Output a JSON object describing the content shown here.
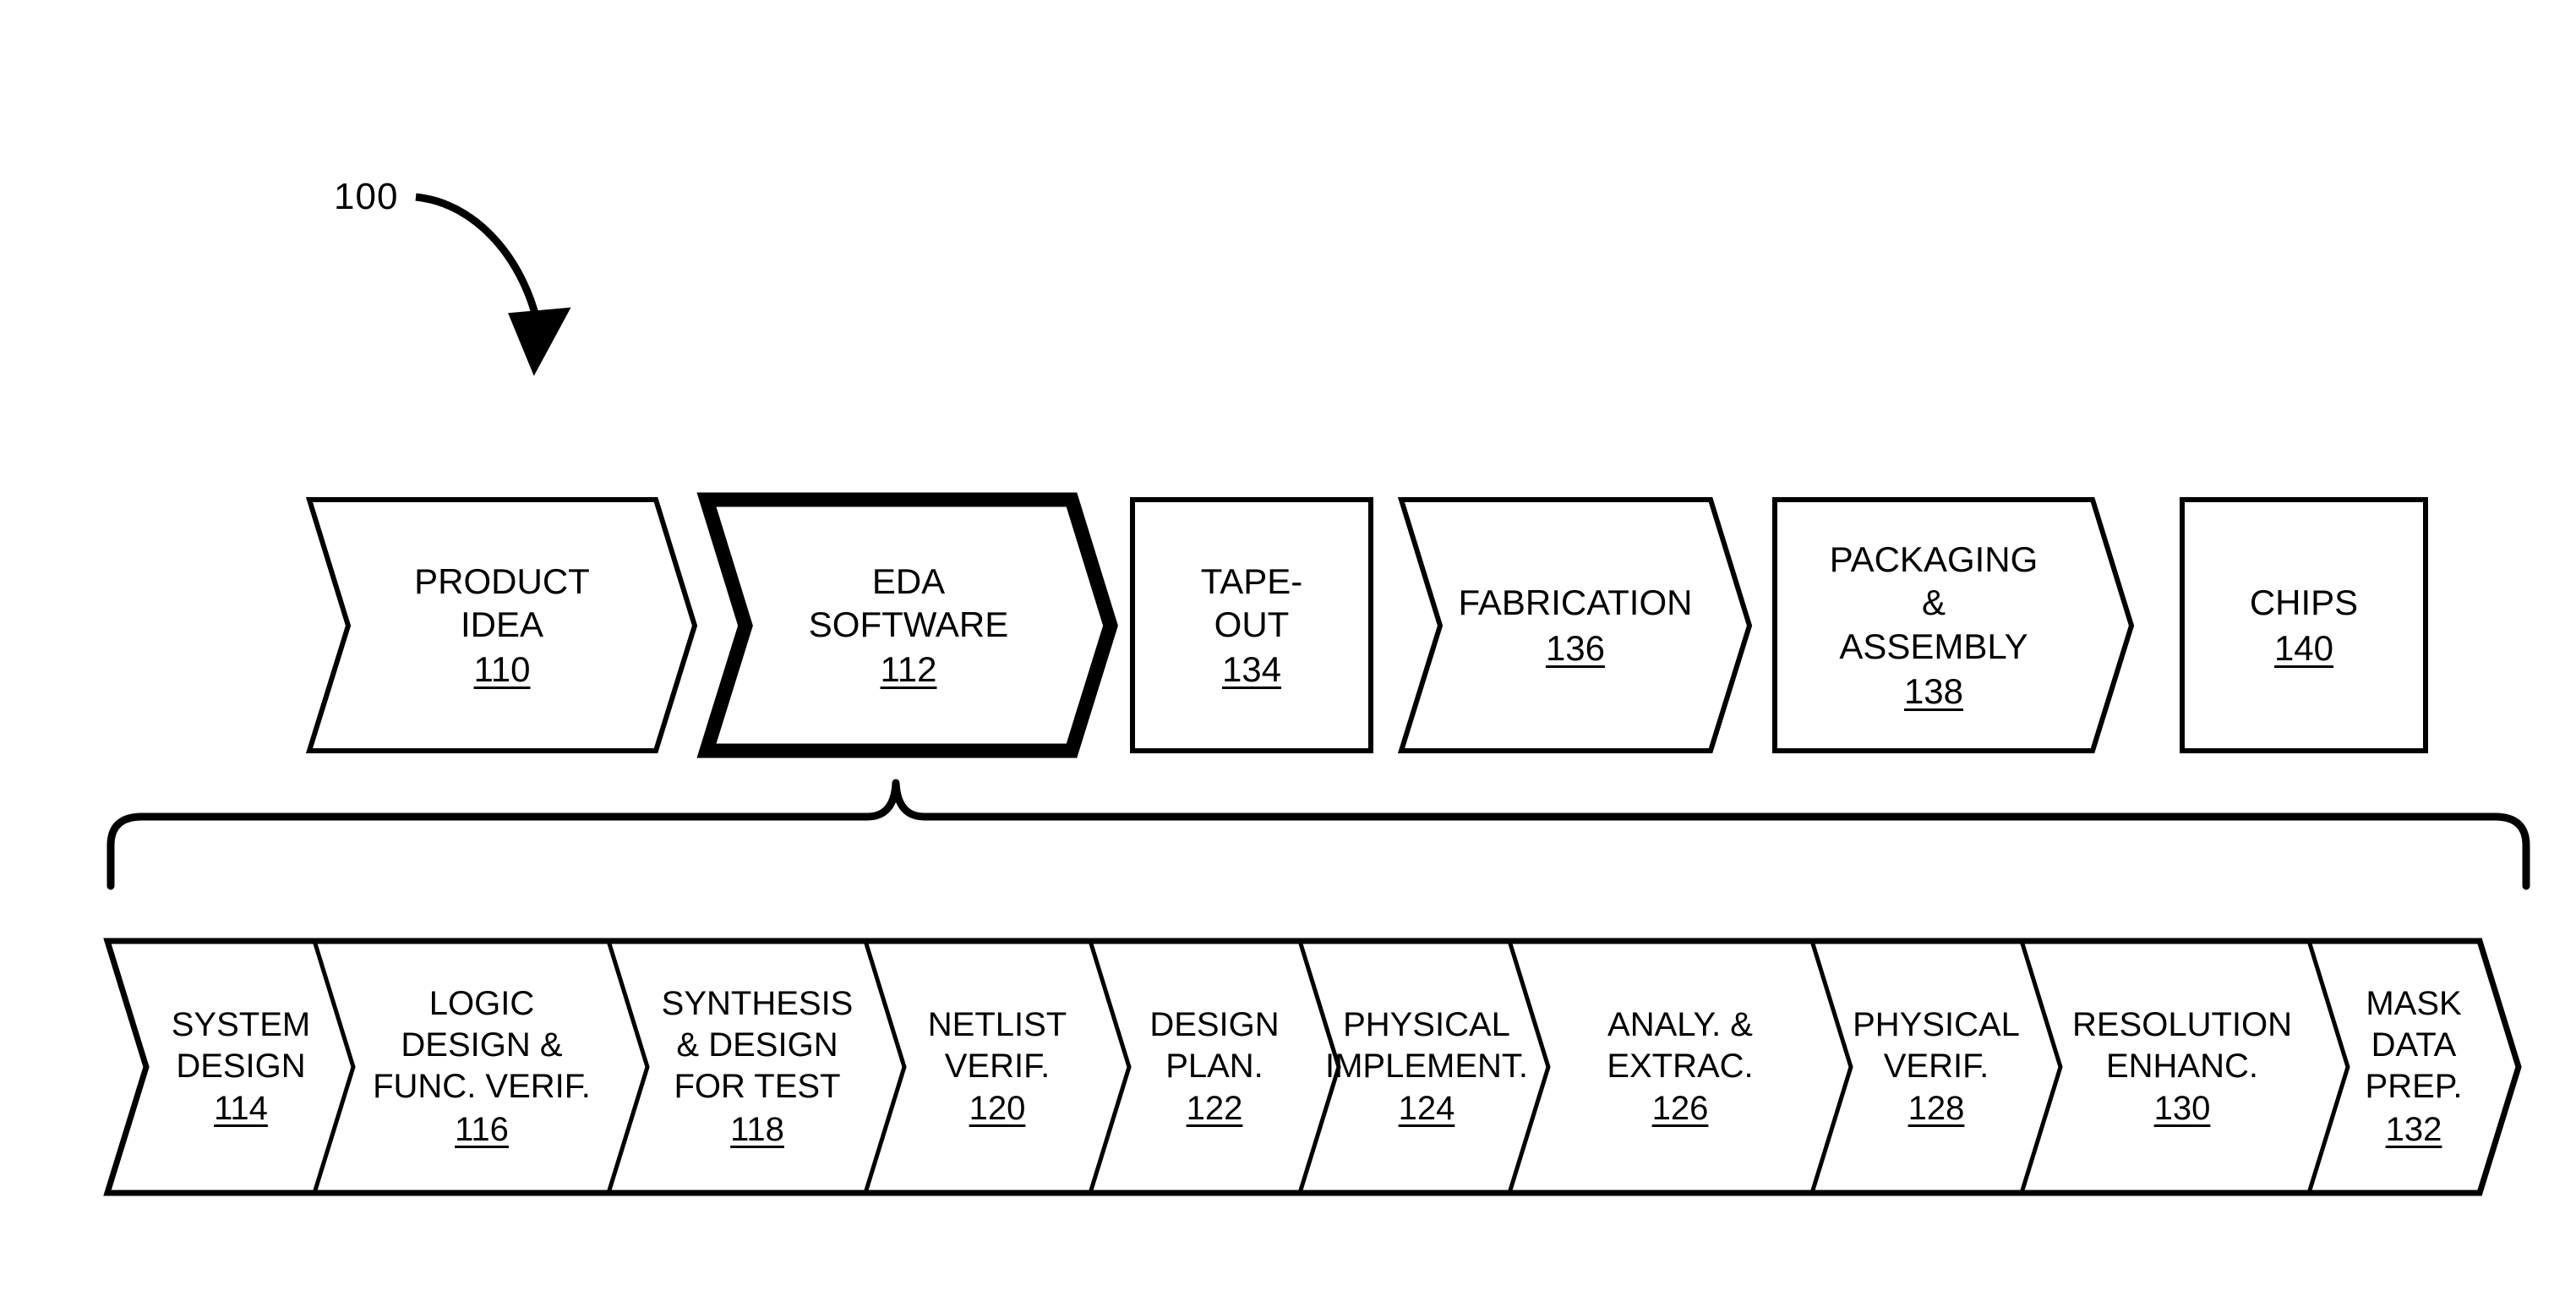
{
  "figure": {
    "reference_numeral": "100",
    "leader_arrow": "curved-arrow-pointing-down-right"
  },
  "top_row": {
    "items": [
      {
        "label": "PRODUCT\nIDEA",
        "number": "110",
        "shape": "chevron",
        "emphasis": "normal"
      },
      {
        "label": "EDA\nSOFTWARE",
        "number": "112",
        "shape": "chevron",
        "emphasis": "bold"
      },
      {
        "label": "TAPE-\nOUT",
        "number": "134",
        "shape": "rectangle",
        "emphasis": "normal"
      },
      {
        "label": "FABRICATION",
        "number": "136",
        "shape": "chevron",
        "emphasis": "normal"
      },
      {
        "label": "PACKAGING\n&\nASSEMBLY",
        "number": "138",
        "shape": "chevron-flat-left",
        "emphasis": "normal"
      },
      {
        "label": "CHIPS",
        "number": "140",
        "shape": "rectangle",
        "emphasis": "normal"
      }
    ]
  },
  "brace": {
    "name": "curly-brace-connecting-eda-software-to-substeps"
  },
  "bottom_row": {
    "items": [
      {
        "label": "SYSTEM\nDESIGN",
        "number": "114"
      },
      {
        "label": "LOGIC\nDESIGN &\nFUNC. VERIF.",
        "number": "116"
      },
      {
        "label": "SYNTHESIS\n& DESIGN\nFOR TEST",
        "number": "118"
      },
      {
        "label": "NETLIST\nVERIF.",
        "number": "120"
      },
      {
        "label": "DESIGN\nPLAN.",
        "number": "122"
      },
      {
        "label": "PHYSICAL\nIMPLEMENT.",
        "number": "124"
      },
      {
        "label": "ANALY. &\nEXTRAC.",
        "number": "126"
      },
      {
        "label": "PHYSICAL\nVERIF.",
        "number": "128"
      },
      {
        "label": "RESOLUTION\nENHANC.",
        "number": "130"
      },
      {
        "label": "MASK\nDATA\nPREP.",
        "number": "132"
      }
    ]
  },
  "colors": {
    "ink": "#000000",
    "paper": "#ffffff"
  }
}
